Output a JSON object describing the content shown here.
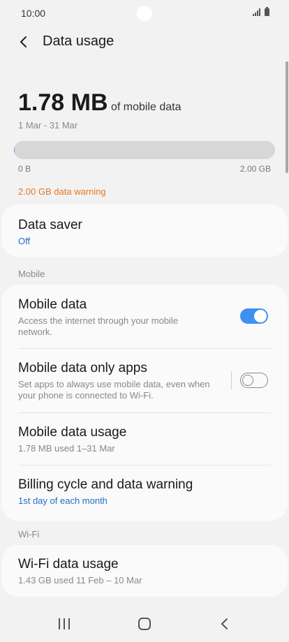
{
  "status_bar": {
    "time": "10:00",
    "icons": [
      "signal-icon",
      "battery-icon"
    ]
  },
  "header": {
    "title": "Data usage",
    "back_icon": "chevron-left-icon"
  },
  "usage": {
    "amount": "1.78 MB",
    "suffix": "of mobile data",
    "period": "1 Mar - 31 Mar",
    "bar_min_label": "0 B",
    "bar_max_label": "2.00 GB",
    "used_fraction": 0.0009,
    "warning": "2.00 GB data warning"
  },
  "data_saver": {
    "title": "Data saver",
    "status": "Off"
  },
  "mobile_section": {
    "label": "Mobile",
    "items": [
      {
        "title": "Mobile data",
        "subtitle": "Access the internet through your mobile network.",
        "toggle": true
      },
      {
        "title": "Mobile data only apps",
        "subtitle": "Set apps to always use mobile data, even when your phone is connected to Wi-Fi.",
        "toggle": false
      },
      {
        "title": "Mobile data usage",
        "subtitle": "1.78 MB used 1–31 Mar"
      },
      {
        "title": "Billing cycle and data warning",
        "subtitle": "1st day of each month"
      }
    ]
  },
  "wifi_section": {
    "label": "Wi-Fi",
    "items": [
      {
        "title": "Wi-Fi data usage",
        "subtitle": "1.43 GB used 11 Feb – 10 Mar"
      }
    ]
  },
  "nav_bar": {
    "icons": [
      "recent-apps-icon",
      "home-icon",
      "back-icon"
    ]
  },
  "colors": {
    "accent": "#3e91f0",
    "link": "#1f6fcc",
    "warning": "#e07a2b",
    "background": "#f2f2f2",
    "card": "#fafafa"
  }
}
